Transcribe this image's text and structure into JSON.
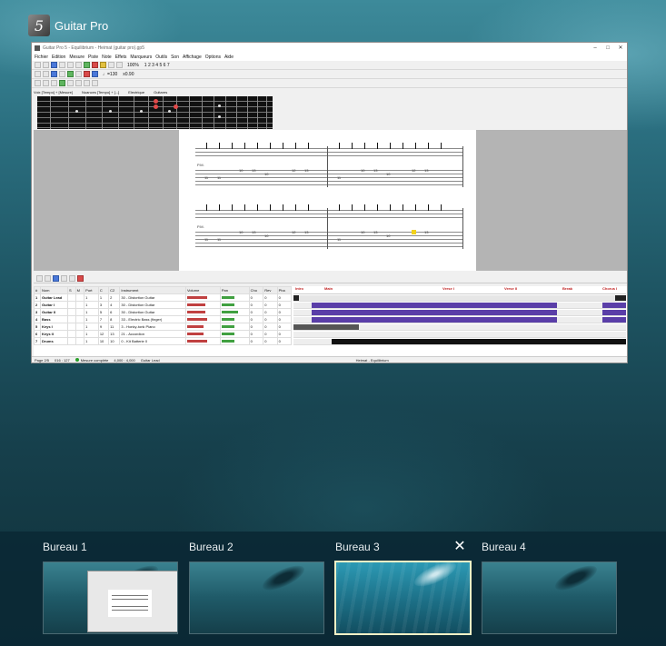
{
  "app": {
    "title": "Guitar Pro",
    "icon": "guitar-pro-icon"
  },
  "window": {
    "caption": "Guitar Pro 5 - Equilibrium - Heimat (guitar pro).gp5",
    "menu": [
      "Fichier",
      "Edition",
      "Mesure",
      "Piste",
      "Note",
      "Effets",
      "Marqueurs",
      "Outils",
      "Son",
      "Affichage",
      "Options",
      "Aide"
    ],
    "zoom": "100%",
    "page_nav": "1 2 3 4 5 6 7",
    "tempo": "♩=130",
    "speed": "x0.90",
    "fretboard_header": [
      "Voix [Tempo] + [Mesure]",
      "Nuances [Tempo] + [...]",
      "Electrique",
      "Guitares"
    ],
    "track_headers": [
      "Nom",
      "S",
      "M",
      "Port",
      "C",
      "C2",
      "Instrument",
      "Volume",
      "Pan",
      "Cho",
      "Rev",
      "Pha"
    ],
    "tracks": [
      {
        "num": "1",
        "name": "Guitar Lead",
        "port": "1",
        "c": "1",
        "c2": "2",
        "instrument": "30 - Distortion Guitar",
        "cho": "0",
        "rev": "0",
        "pha": "0"
      },
      {
        "num": "2",
        "name": "Guitar I",
        "port": "1",
        "c": "3",
        "c2": "4",
        "instrument": "30 - Distortion Guitar",
        "cho": "0",
        "rev": "0",
        "pha": "0"
      },
      {
        "num": "3",
        "name": "Guitar II",
        "port": "1",
        "c": "5",
        "c2": "6",
        "instrument": "30 - Distortion Guitar",
        "cho": "0",
        "rev": "0",
        "pha": "0"
      },
      {
        "num": "4",
        "name": "Bass",
        "port": "1",
        "c": "7",
        "c2": "8",
        "instrument": "33 - Electric Bass (finger)",
        "cho": "0",
        "rev": "0",
        "pha": "0"
      },
      {
        "num": "5",
        "name": "Keys I",
        "port": "1",
        "c": "9",
        "c2": "11",
        "instrument": "3 - Honky-tonk Piano",
        "cho": "0",
        "rev": "0",
        "pha": "0"
      },
      {
        "num": "6",
        "name": "Keys II",
        "port": "1",
        "c": "12",
        "c2": "13",
        "instrument": "21 - Accordion",
        "cho": "0",
        "rev": "0",
        "pha": "0"
      },
      {
        "num": "7",
        "name": "Drums",
        "port": "1",
        "c": "10",
        "c2": "10",
        "instrument": "0 - Kit Batterie 0",
        "cho": "0",
        "rev": "0",
        "pha": "0"
      }
    ],
    "sections": [
      "Intro",
      "Main",
      "Verse I",
      "Verse II",
      "Break",
      "Chorus I"
    ],
    "status": {
      "page": "Page 2/5",
      "position": "016 : 127",
      "measure_state": "Mesure complète",
      "time": "4,000 : 4,000",
      "track": "Guitar Lead",
      "song": "Heimat - Equilibrium"
    }
  },
  "desktops": [
    {
      "label": "Bureau 1",
      "active": false
    },
    {
      "label": "Bureau 2",
      "active": false
    },
    {
      "label": "Bureau 3",
      "active": true
    },
    {
      "label": "Bureau 4",
      "active": false
    }
  ],
  "colors": {
    "desktop_bar": "#0a2834",
    "active_border": "#f5f1c6",
    "track_purple": "#5a3ea8",
    "section_red": "#c02020"
  }
}
